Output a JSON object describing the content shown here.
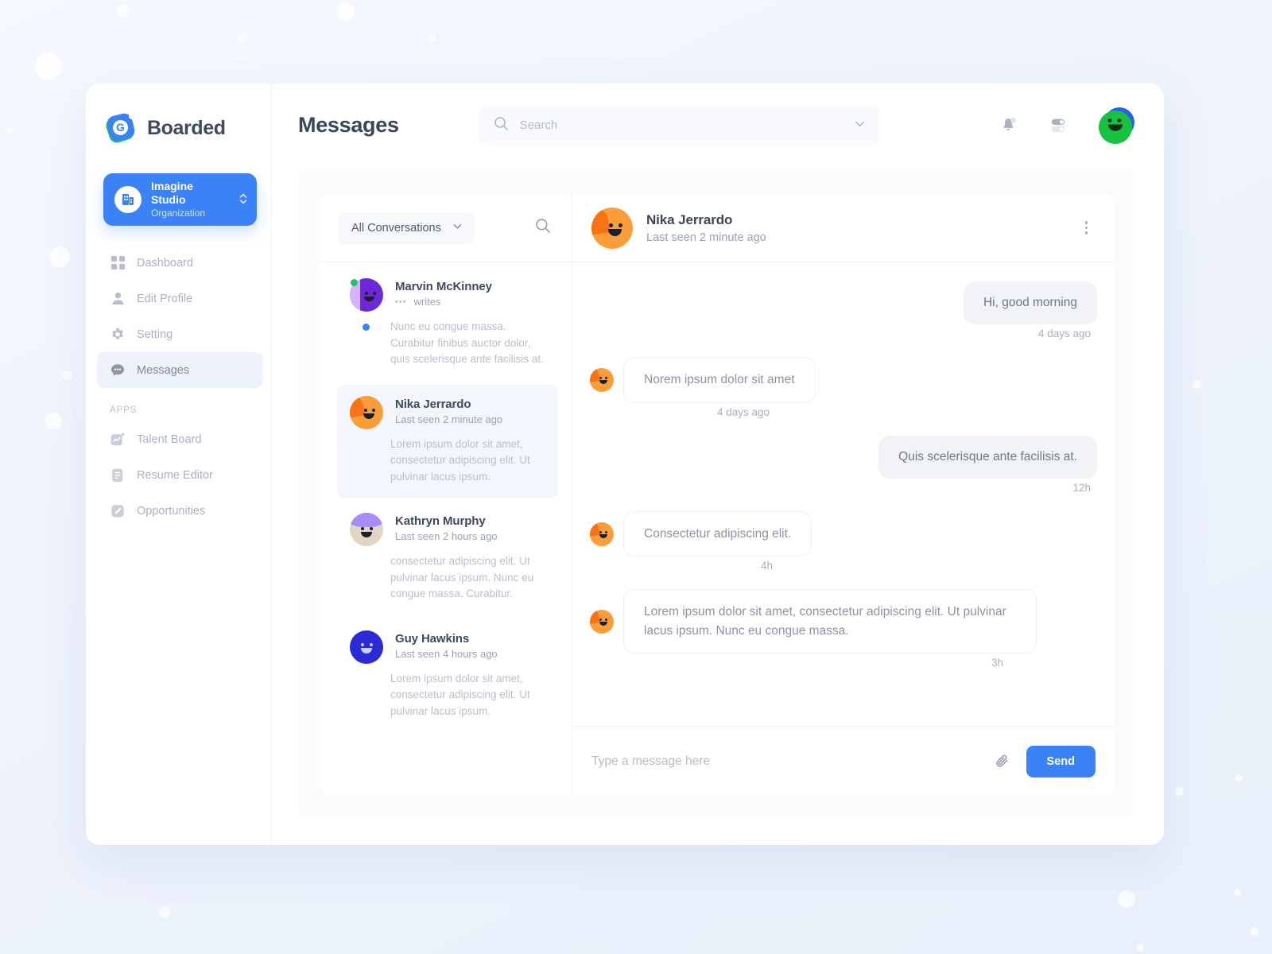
{
  "brand": {
    "name": "Boarded",
    "logo_icon": "boarded-logo-icon"
  },
  "org": {
    "title": "Imagine Studio",
    "subtitle": "Organization",
    "icon": "building-icon",
    "accent": "#3b82f6"
  },
  "sidebar": {
    "items": [
      {
        "label": "Dashboard",
        "icon": "grid-icon",
        "active": false
      },
      {
        "label": "Edit Profile",
        "icon": "user-icon",
        "active": false
      },
      {
        "label": "Setting",
        "icon": "gear-icon",
        "active": false
      },
      {
        "label": "Messages",
        "icon": "chat-bubble-icon",
        "active": true
      }
    ],
    "section_label": "APPS",
    "apps": [
      {
        "label": "Talent Board",
        "icon": "chart-square-icon"
      },
      {
        "label": "Resume Editor",
        "icon": "document-icon"
      },
      {
        "label": "Opportunities",
        "icon": "pencil-square-icon"
      }
    ]
  },
  "header": {
    "title": "Messages",
    "search_placeholder": "Search",
    "search_value": "",
    "search_icon": "search-icon",
    "dropdown_icon": "chevron-down-icon",
    "bell_icon": "bell-icon",
    "toggles_icon": "sliders-toggle-icon",
    "avatar_icon": "user-avatar"
  },
  "conversations": {
    "filter_label": "All Conversations",
    "filter_icon": "chevron-down-icon",
    "search_icon": "search-icon",
    "items": [
      {
        "name": "Marvin McKinney",
        "status": "writes",
        "typing": true,
        "unread": true,
        "selected": false,
        "snippet": "Nunc eu congue massa. Curabitur finibus auctor dolor, quis scelerisque ante facilisis at.",
        "avatar": "avatar-purple"
      },
      {
        "name": "Nika Jerrardo",
        "status": "Last seen 2 minute ago",
        "typing": false,
        "unread": false,
        "selected": true,
        "snippet": "Lorem ipsum dolor sit amet, consectetur adipiscing elit. Ut pulvinar lacus ipsum.",
        "avatar": "avatar-orange"
      },
      {
        "name": "Kathryn Murphy",
        "status": "Last seen 2 hours ago",
        "typing": false,
        "unread": false,
        "selected": false,
        "snippet": " consectetur adipiscing elit. Ut pulvinar lacus ipsum. Nunc eu congue massa. Curabitur.",
        "avatar": "avatar-tan"
      },
      {
        "name": "Guy Hawkins",
        "status": "Last seen 4 hours ago",
        "typing": false,
        "unread": false,
        "selected": false,
        "snippet": "Lorem ipsum dolor sit amet, consectetur adipiscing elit. Ut pulvinar lacus ipsum.",
        "avatar": "avatar-blue"
      }
    ]
  },
  "chat": {
    "contact_name": "Nika Jerrardo",
    "contact_status": "Last seen 2 minute ago",
    "menu_icon": "kebab-menu-icon",
    "messages": [
      {
        "text": "Hi, good morning",
        "direction": "out",
        "time": "4 days ago"
      },
      {
        "text": "Norem ipsum dolor sit amet",
        "direction": "in",
        "time": "4 days ago"
      },
      {
        "text": "Quis scelerisque ante facilisis at.",
        "direction": "out",
        "time": "12h"
      },
      {
        "text": "Consectetur adipiscing elit.",
        "direction": "in",
        "time": "4h"
      },
      {
        "text": "Lorem ipsum dolor sit amet, consectetur adipiscing elit. Ut pulvinar lacus ipsum. Nunc eu congue massa.",
        "direction": "in",
        "time": "3h"
      }
    ],
    "composer": {
      "placeholder": "Type a message here",
      "value": "",
      "attach_icon": "paperclip-icon",
      "send_label": "Send"
    }
  }
}
